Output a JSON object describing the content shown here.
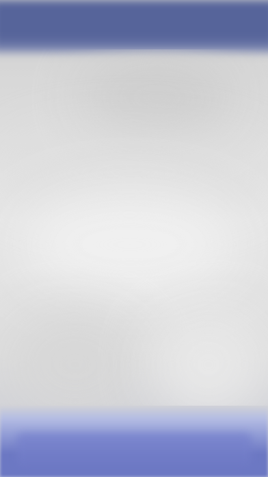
{
  "screen": {
    "state": "blurred",
    "header": {
      "color": "#56649a"
    },
    "content": {
      "color": "#e0e0e0"
    },
    "bottom_action": {
      "color": "#6c78c3"
    }
  }
}
